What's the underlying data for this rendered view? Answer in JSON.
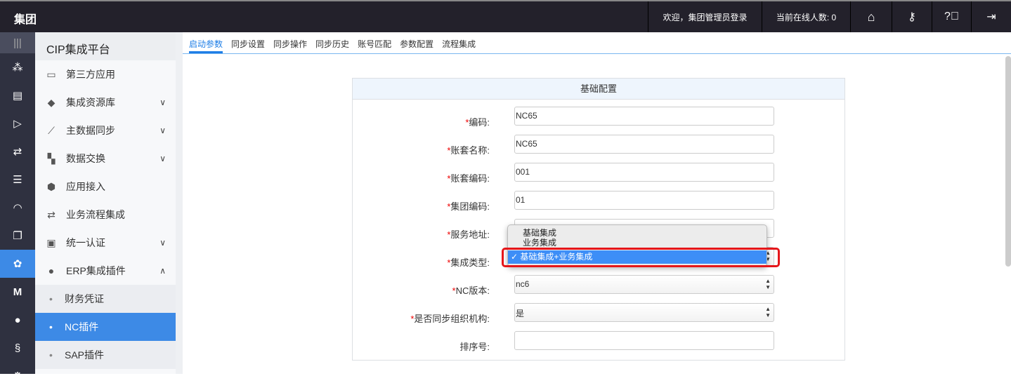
{
  "header": {
    "brand": "集团",
    "welcome": "欢迎，集团管理员登录",
    "online": "当前在线人数: 0"
  },
  "rail_icons": [
    "menu-icon",
    "org-tree-icon",
    "settings-panel-icon",
    "send-icon",
    "flow-icon",
    "database-icon",
    "dashboard-icon",
    "document-icon",
    "plugin-icon",
    "m-icon",
    "wechat-icon",
    "s-logo-icon",
    "gear-icon"
  ],
  "menu": {
    "title": "CIP集成平台",
    "items": [
      {
        "label": "第三方应用",
        "icon": "monitor-icon",
        "chev": ""
      },
      {
        "label": "集成资源库",
        "icon": "tag-icon",
        "chev": "∨"
      },
      {
        "label": "主数据同步",
        "icon": "line-chart-icon",
        "chev": "∨"
      },
      {
        "label": "数据交换",
        "icon": "exchange-icon",
        "chev": "∨"
      },
      {
        "label": "应用接入",
        "icon": "cube-icon",
        "chev": ""
      },
      {
        "label": "业务流程集成",
        "icon": "flow-icon",
        "chev": ""
      },
      {
        "label": "统一认证",
        "icon": "auth-icon",
        "chev": "∨"
      },
      {
        "label": "ERP集成插件",
        "icon": "erp-icon",
        "chev": "∧"
      }
    ],
    "sub": [
      "财务凭证",
      "NC插件",
      "SAP插件"
    ]
  },
  "tabs": [
    "启动参数",
    "同步设置",
    "同步操作",
    "同步历史",
    "账号匹配",
    "参数配置",
    "流程集成"
  ],
  "form": {
    "title": "基础配置",
    "fields": [
      {
        "label": "编码:",
        "req": "*",
        "value": "NC65"
      },
      {
        "label": "账套名称:",
        "req": "*",
        "value": "NC65"
      },
      {
        "label": "账套编码:",
        "req": "*",
        "value": "001"
      },
      {
        "label": "集团编码:",
        "req": "*",
        "value": "01"
      },
      {
        "label": "服务地址:",
        "req": "*",
        "value": ""
      },
      {
        "label": "集成类型:",
        "req": "*",
        "value": "基础集成+业务集成"
      },
      {
        "label": "NC版本:",
        "req": "*",
        "value": "nc6"
      },
      {
        "label": "是否同步组织机构:",
        "req": "*",
        "value": "是"
      },
      {
        "label": "排序号:",
        "req": "",
        "value": ""
      }
    ]
  },
  "dropdown": {
    "options": [
      "基础集成",
      "业务集成",
      "基础集成+业务集成"
    ],
    "check": "✓"
  }
}
